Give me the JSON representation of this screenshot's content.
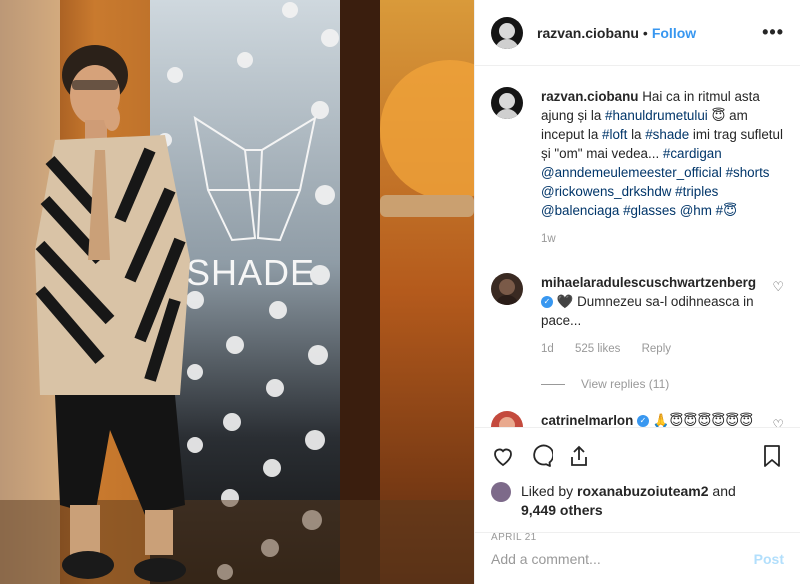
{
  "post": {
    "username": "razvan.ciobanu",
    "dot": "•",
    "follow_label": "Follow",
    "more_label": "•••",
    "photo_banner_text": "SHADE"
  },
  "caption": {
    "username": "razvan.ciobanu",
    "parts": [
      {
        "t": "Hai ca in ritmul asta ajung și la ",
        "tag": false
      },
      {
        "t": "#hanuldrumetului",
        "tag": true
      },
      {
        "t": " 😇 am inceput la ",
        "tag": false
      },
      {
        "t": "#loft",
        "tag": true
      },
      {
        "t": " la ",
        "tag": false
      },
      {
        "t": "#shade",
        "tag": true
      },
      {
        "t": " imi trag sufletul și \"om\" mai vedea... ",
        "tag": false
      },
      {
        "t": "#cardigan",
        "tag": true
      },
      {
        "t": " ",
        "tag": false
      },
      {
        "t": "@anndemeulemeester_official",
        "tag": true
      },
      {
        "t": " ",
        "tag": false
      },
      {
        "t": "#shorts",
        "tag": true
      },
      {
        "t": " ",
        "tag": false
      },
      {
        "t": "@rickowens_drkshdw",
        "tag": true
      },
      {
        "t": " ",
        "tag": false
      },
      {
        "t": "#triples",
        "tag": true
      },
      {
        "t": " ",
        "tag": false
      },
      {
        "t": "@balenciaga",
        "tag": true
      },
      {
        "t": " ",
        "tag": false
      },
      {
        "t": "#glasses",
        "tag": true
      },
      {
        "t": " ",
        "tag": false
      },
      {
        "t": "@hm",
        "tag": true
      },
      {
        "t": " ",
        "tag": false
      },
      {
        "t": "#😇",
        "tag": true
      }
    ],
    "age": "1w"
  },
  "comments": [
    {
      "username": "mihaelaradulescuschwartzenberg",
      "verified_mark": "✓",
      "text": "🖤 Dumnezeu sa-l odihneasca in pace...",
      "age": "1d",
      "likes": "525 likes",
      "reply_label": "Reply",
      "heart": "♡",
      "view_replies": "View replies (11)"
    },
    {
      "username": "catrinelmarlon",
      "verified_mark": "✓",
      "text": "🙏😇😇😇😇😇😇",
      "heart": "♡"
    }
  ],
  "actions": {
    "liked_by_prefix": "Liked by ",
    "liked_by_user": "roxanabuzoiuteam2",
    "liked_and": " and",
    "others": "9,449 others",
    "date": "April 21"
  },
  "add_comment": {
    "placeholder": "Add a comment...",
    "post_label": "Post"
  }
}
